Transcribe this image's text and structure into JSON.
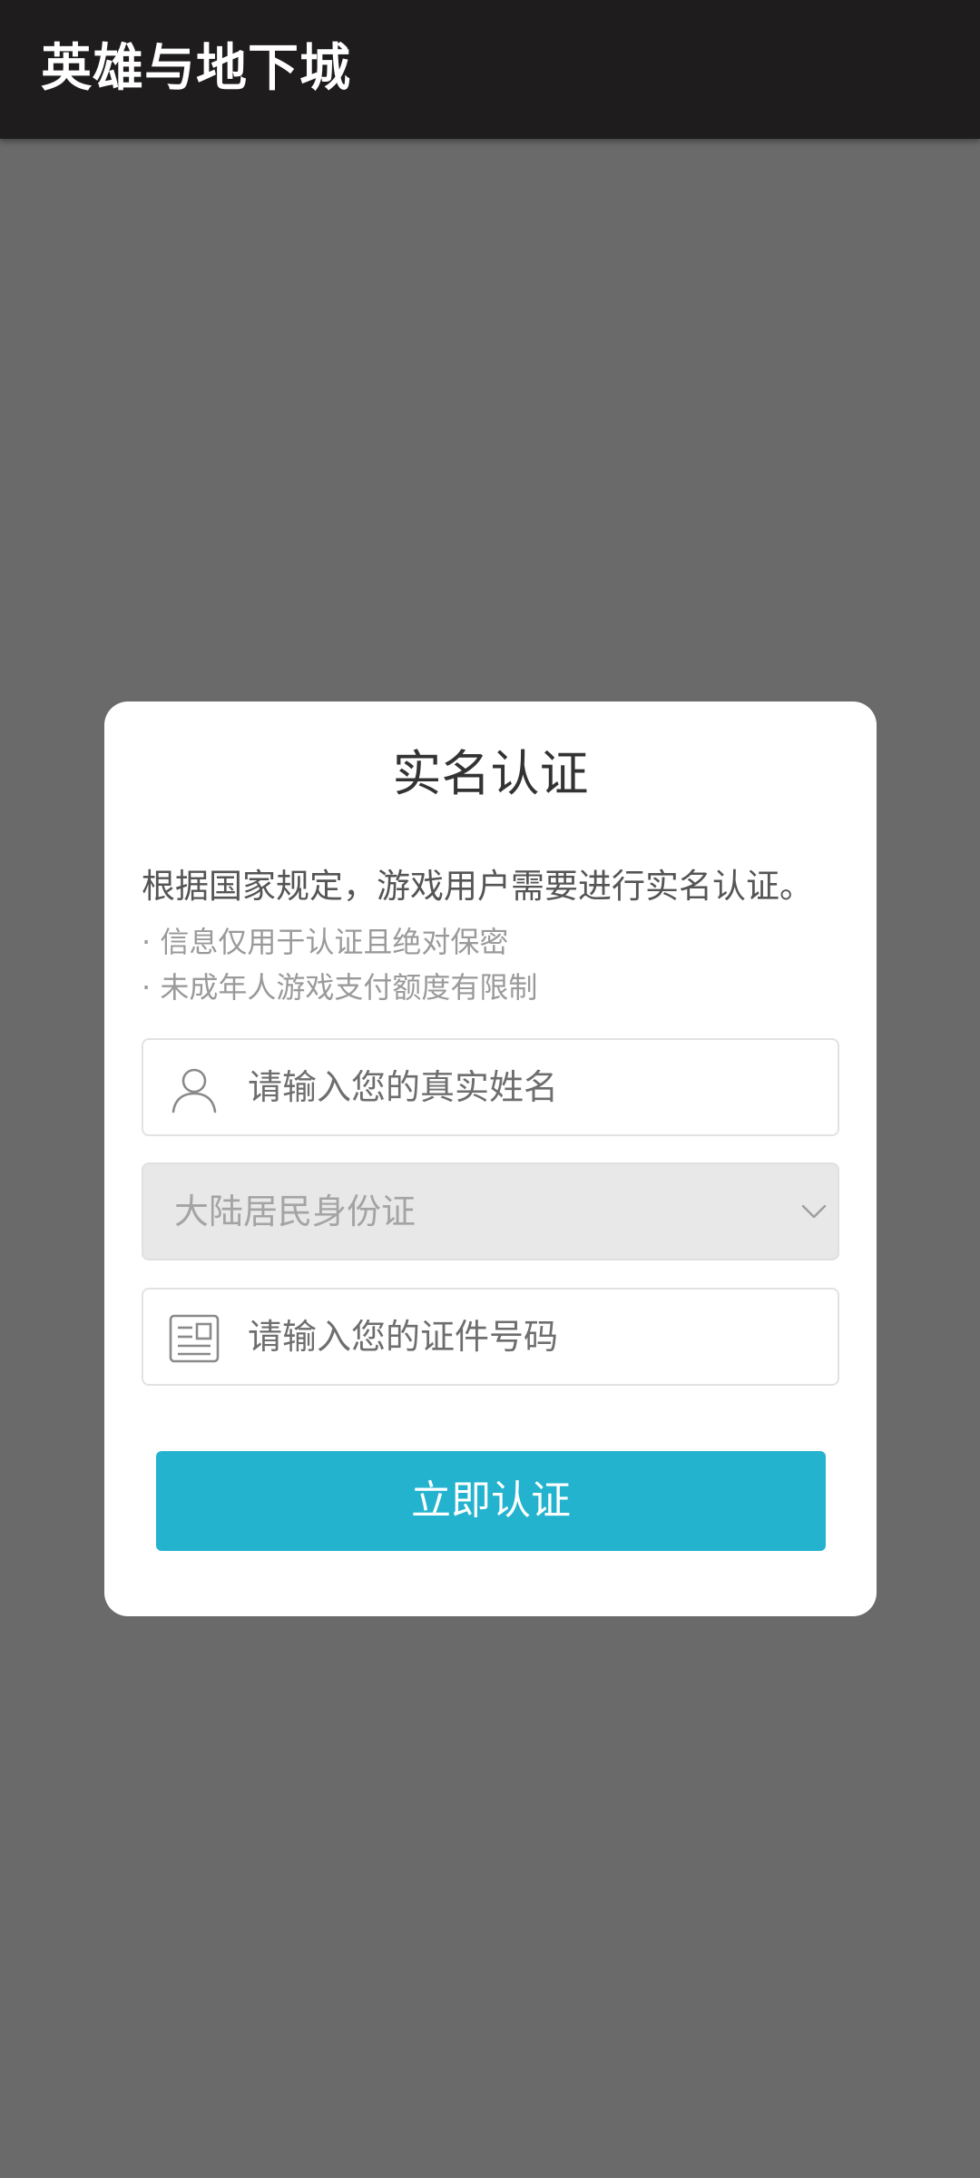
{
  "appbar": {
    "title": "英雄与地下城"
  },
  "dialog": {
    "title": "实名认证",
    "notice": "根据国家规定，游戏用户需要进行实名认证。",
    "bullets": [
      "· 信息仅用于认证且绝对保密",
      "· 未成年人游戏支付额度有限制"
    ],
    "name_field": {
      "placeholder": "请输入您的真实姓名",
      "icon": "person-icon"
    },
    "id_type_select": {
      "value": "大陆居民身份证",
      "icon": "chevron-down-icon"
    },
    "id_number_field": {
      "placeholder": "请输入您的证件号码",
      "icon": "id-card-icon"
    },
    "submit_label": "立即认证"
  },
  "colors": {
    "overlay": "#6a6a6a",
    "appbar": "#1f1c1d",
    "accent": "#23b3cf"
  }
}
